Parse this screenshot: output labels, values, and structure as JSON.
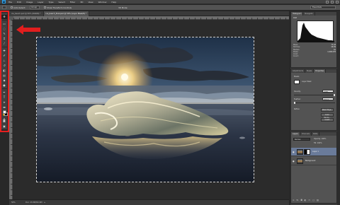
{
  "app": {
    "logo": "Ps",
    "menus": [
      "File",
      "Edit",
      "Image",
      "Layer",
      "Type",
      "Select",
      "Filter",
      "3D",
      "View",
      "Window",
      "Help"
    ]
  },
  "options": {
    "autoselect_label": "Auto-Select:",
    "autoselect_value": "Group",
    "transform_label": "Show Transform Controls",
    "mode_label": "3D Mode:",
    "workspace": "Essentials"
  },
  "document": {
    "tabs": [
      {
        "label": "ice_beach.psd @ 50% (RGB/8) *",
        "active": false
      },
      {
        "label": "ice_beach_final.psd @ 50% (Layer Mask/8) *",
        "active": true
      }
    ],
    "zoom": "50%",
    "doc_info": "Doc: 45.8M/91.6M"
  },
  "tools": [
    {
      "icon": "move-icon",
      "glyph": "✥",
      "active": true
    },
    {
      "icon": "marquee-icon",
      "glyph": "▭"
    },
    {
      "icon": "lasso-icon",
      "glyph": "◌"
    },
    {
      "icon": "quick-select-icon",
      "glyph": "✎"
    },
    {
      "icon": "crop-icon",
      "glyph": "⌗"
    },
    {
      "icon": "eyedropper-icon",
      "glyph": "⁄"
    },
    {
      "icon": "healing-icon",
      "glyph": "✚"
    },
    {
      "icon": "brush-icon",
      "glyph": "✐"
    },
    {
      "icon": "stamp-icon",
      "glyph": "⊥"
    },
    {
      "icon": "history-brush-icon",
      "glyph": "↺"
    },
    {
      "icon": "eraser-icon",
      "glyph": "◧"
    },
    {
      "icon": "gradient-icon",
      "glyph": "▤"
    },
    {
      "icon": "blur-icon",
      "glyph": "◆"
    },
    {
      "icon": "dodge-icon",
      "glyph": "●"
    },
    {
      "icon": "pen-icon",
      "glyph": "✒"
    },
    {
      "icon": "type-icon",
      "glyph": "T"
    },
    {
      "icon": "path-select-icon",
      "glyph": "➤"
    },
    {
      "icon": "shape-icon",
      "glyph": "▬"
    },
    {
      "icon": "hand-icon",
      "glyph": "✋"
    },
    {
      "icon": "zoom-icon",
      "glyph": "⚲"
    }
  ],
  "histogram": {
    "tabs": [
      "Histogram",
      "Navigator"
    ],
    "stats": [
      {
        "label": "Mean:",
        "value": "73.43"
      },
      {
        "label": "Std Dev:",
        "value": "46.59"
      },
      {
        "label": "Median:",
        "value": "61"
      },
      {
        "label": "Pixels:",
        "value": "1,048,576"
      },
      {
        "label": "Level:",
        "value": ""
      },
      {
        "label": "Count:",
        "value": ""
      }
    ],
    "channel": "RGB"
  },
  "properties": {
    "tabs": [
      "Adjustments",
      "Styles",
      "Properties"
    ],
    "title": "Masks",
    "mask_label": "Layer Mask",
    "density_label": "Density:",
    "density_value": "100%",
    "feather_label": "Feather:",
    "feather_value": "0.0 px",
    "refine_label": "Refine:",
    "buttons": [
      "Mask Edge...",
      "Color Range...",
      "Invert"
    ]
  },
  "layers": {
    "tabs": [
      "Layers",
      "Channels",
      "Paths"
    ],
    "mode": "Normal",
    "opacity_label": "Opacity:",
    "opacity_value": "100%",
    "fill_label": "Fill:",
    "fill_value": "100%",
    "items": [
      {
        "name": "Layer 1",
        "selected": true
      },
      {
        "name": "Background",
        "selected": false
      }
    ]
  }
}
